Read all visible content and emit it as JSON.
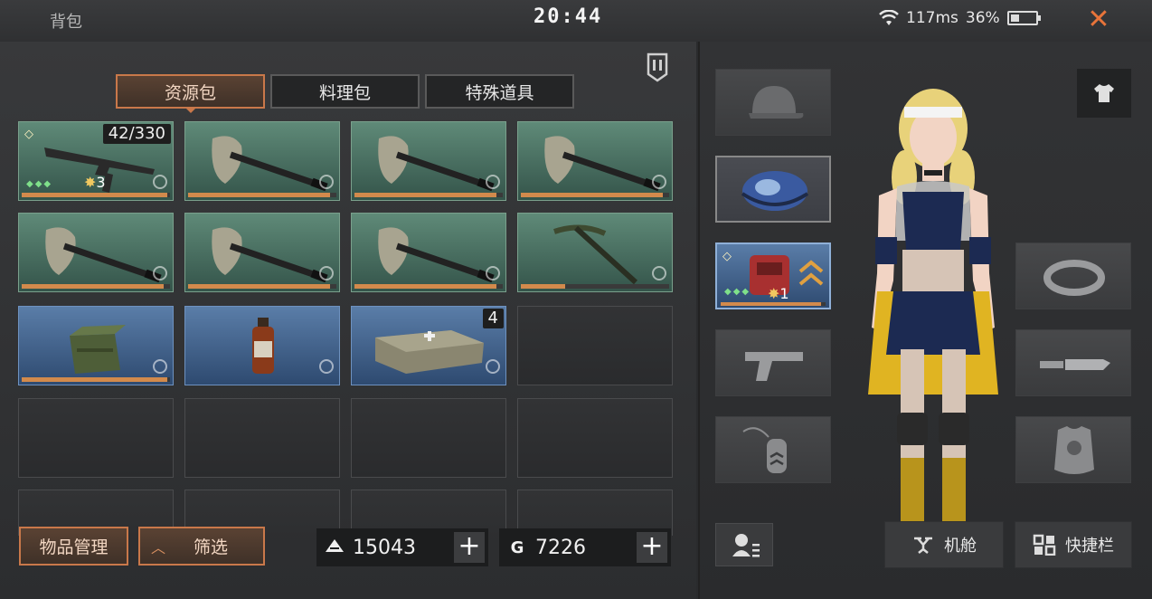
{
  "header": {
    "title": "背包",
    "clock": "20:44",
    "ping": "117ms",
    "battery_text": "36%",
    "battery_level": 0.36
  },
  "tabs": [
    {
      "label": "资源包",
      "active": true
    },
    {
      "label": "料理包",
      "active": false
    },
    {
      "label": "特殊道具",
      "active": false
    }
  ],
  "inventory": [
    {
      "item": "assault-rifle",
      "count": "42/330",
      "star_count": "3",
      "durability": 0.98
    },
    {
      "item": "axe",
      "durability": 0.96
    },
    {
      "item": "axe",
      "durability": 0.96
    },
    {
      "item": "axe",
      "durability": 0.96
    },
    {
      "item": "axe",
      "durability": 0.96
    },
    {
      "item": "axe",
      "durability": 0.96
    },
    {
      "item": "axe",
      "durability": 0.96
    },
    {
      "item": "pickaxe",
      "durability": 0.3
    },
    {
      "item": "ammo-crate",
      "durability": 0.98
    },
    {
      "item": "medicine-bottle"
    },
    {
      "item": "medkit",
      "count": "4"
    }
  ],
  "footer": {
    "manage_label": "物品管理",
    "filter_label": "筛选",
    "currency1_value": "15043",
    "currency2_value": "7226",
    "currency2_symbol": "G"
  },
  "equipment": {
    "backpack_star": "1",
    "hangar_label": "机舱",
    "shortcut_label": "快捷栏"
  },
  "colors": {
    "accent_orange": "#c9784a",
    "close_x": "#e8743a",
    "rarity_green": "#4f7a68",
    "rarity_blue": "#4468a0"
  }
}
